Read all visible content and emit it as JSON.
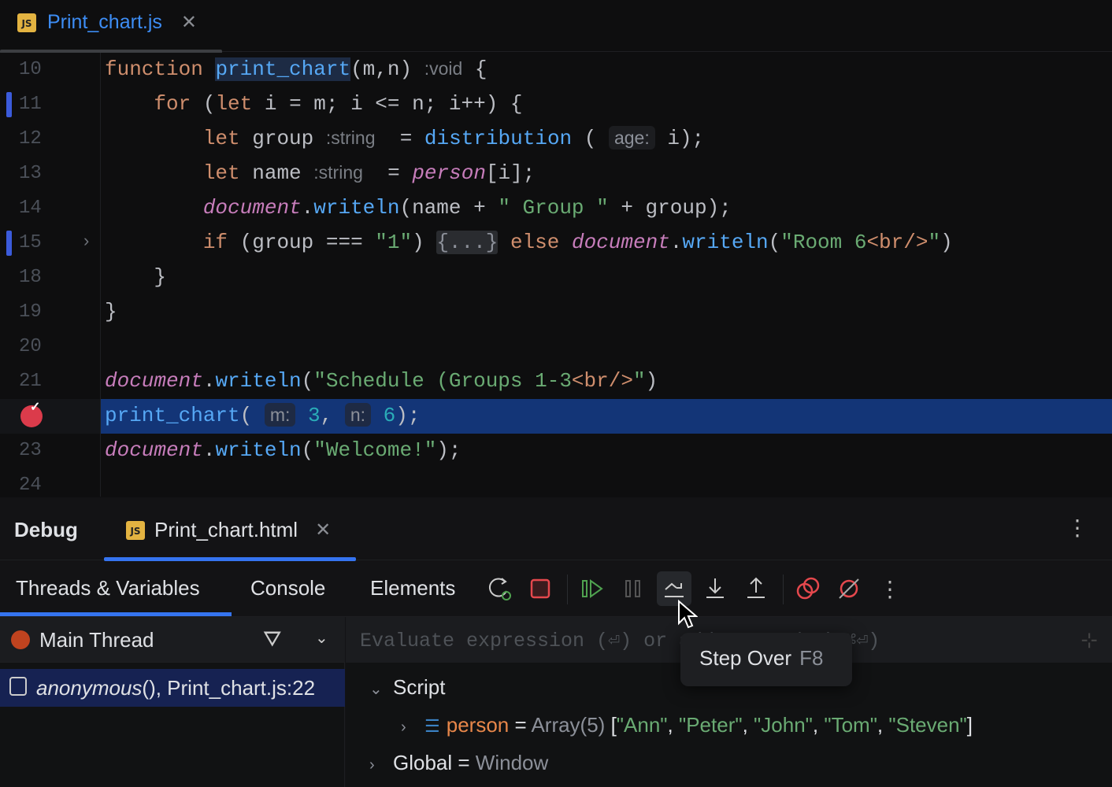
{
  "editor_tab": {
    "icon": "js-file-icon",
    "label": "Print_chart.js"
  },
  "code": [
    {
      "ln": "10",
      "mark": false,
      "toks": [
        [
          "kw",
          "function "
        ],
        [
          "fn sel",
          "print_chart"
        ],
        [
          "",
          "(m,n) "
        ],
        [
          "hint",
          ":void"
        ],
        [
          "",
          " {"
        ]
      ]
    },
    {
      "ln": "11",
      "mark": true,
      "toks": [
        [
          "",
          "    "
        ],
        [
          "kw",
          "for"
        ],
        [
          "",
          " ("
        ],
        [
          "kw",
          "let"
        ],
        [
          "",
          " i = m; i <= n; i++) {"
        ]
      ]
    },
    {
      "ln": "12",
      "mark": false,
      "toks": [
        [
          "",
          "        "
        ],
        [
          "kw",
          "let"
        ],
        [
          "",
          " group "
        ],
        [
          "hint",
          ":string"
        ],
        [
          "",
          "  = "
        ],
        [
          "fn",
          "distribution"
        ],
        [
          "",
          " ( "
        ],
        [
          "hintbox2",
          "age:"
        ],
        [
          "",
          " i);"
        ]
      ]
    },
    {
      "ln": "13",
      "mark": false,
      "toks": [
        [
          "",
          "        "
        ],
        [
          "kw",
          "let"
        ],
        [
          "",
          " name "
        ],
        [
          "hint",
          ":string"
        ],
        [
          "",
          "  = "
        ],
        [
          "it",
          "person"
        ],
        [
          "",
          "[i];"
        ]
      ]
    },
    {
      "ln": "14",
      "mark": false,
      "toks": [
        [
          "",
          "        "
        ],
        [
          "it",
          "document"
        ],
        [
          "",
          "."
        ],
        [
          "fn",
          "writeln"
        ],
        [
          "",
          "(name + "
        ],
        [
          "str",
          "\" Group \""
        ],
        [
          "",
          " + group);"
        ]
      ]
    },
    {
      "ln": "15",
      "mark": true,
      "fold": true,
      "toks": [
        [
          "",
          "        "
        ],
        [
          "kw",
          "if"
        ],
        [
          "",
          " (group === "
        ],
        [
          "str",
          "\"1\""
        ],
        [
          "",
          ") "
        ],
        [
          "fold",
          "{...}"
        ],
        [
          "",
          " "
        ],
        [
          "kw",
          "else"
        ],
        [
          "",
          " "
        ],
        [
          "it",
          "document"
        ],
        [
          "",
          "."
        ],
        [
          "fn",
          "writeln"
        ],
        [
          "",
          "("
        ],
        [
          "str",
          "\"Room 6"
        ],
        [
          "kw",
          "<br/>"
        ],
        [
          "str",
          "\""
        ],
        [
          "",
          ")"
        ]
      ]
    },
    {
      "ln": "18",
      "mark": false,
      "toks": [
        [
          "",
          "    }"
        ]
      ]
    },
    {
      "ln": "19",
      "mark": false,
      "toks": [
        [
          "",
          "}"
        ]
      ]
    },
    {
      "ln": "20",
      "mark": false,
      "toks": []
    },
    {
      "ln": "21",
      "mark": false,
      "toks": [
        [
          "it",
          "document"
        ],
        [
          "",
          "."
        ],
        [
          "fn",
          "writeln"
        ],
        [
          "",
          "("
        ],
        [
          "str",
          "\"Schedule (Groups 1-3"
        ],
        [
          "kw",
          "<br/>"
        ],
        [
          "str",
          "\""
        ],
        [
          "",
          ")"
        ]
      ]
    },
    {
      "ln": "",
      "exec": true,
      "toks": [
        [
          "fn",
          "print_chart"
        ],
        [
          "",
          "( "
        ],
        [
          "hintbox",
          "m:"
        ],
        [
          "",
          " "
        ],
        [
          "num",
          "3"
        ],
        [
          "",
          ", "
        ],
        [
          "hintbox",
          "n:"
        ],
        [
          "",
          " "
        ],
        [
          "num",
          "6"
        ],
        [
          "",
          ");"
        ]
      ]
    },
    {
      "ln": "23",
      "mark": false,
      "toks": [
        [
          "it",
          "document"
        ],
        [
          "",
          "."
        ],
        [
          "fn",
          "writeln"
        ],
        [
          "",
          "("
        ],
        [
          "str",
          "\"Welcome!\""
        ],
        [
          "",
          ");"
        ]
      ]
    },
    {
      "ln": "24",
      "mark": false,
      "toks": []
    }
  ],
  "panel": {
    "title": "Debug",
    "tab": "Print_chart.html",
    "subtabs": [
      "Threads & Variables",
      "Console",
      "Elements"
    ],
    "thread": "Main Thread",
    "frame_fn": "anonymous",
    "frame_rest": "(), Print_chart.js:22",
    "eval_placeholder": "Evaluate expression (⏎) or add a watch (⇧⌘⏎)",
    "script_label": "Script",
    "var_name": "person",
    "var_eq": " = ",
    "var_type": "Array(5) ",
    "var_open": "[",
    "var_items": [
      "\"Ann\"",
      "\"Peter\"",
      "\"John\"",
      "\"Tom\"",
      "\"Steven\""
    ],
    "var_close": "]",
    "global_label": "Global",
    "global_value": "Window"
  },
  "tooltip": {
    "label": "Step Over",
    "key": "F8"
  }
}
